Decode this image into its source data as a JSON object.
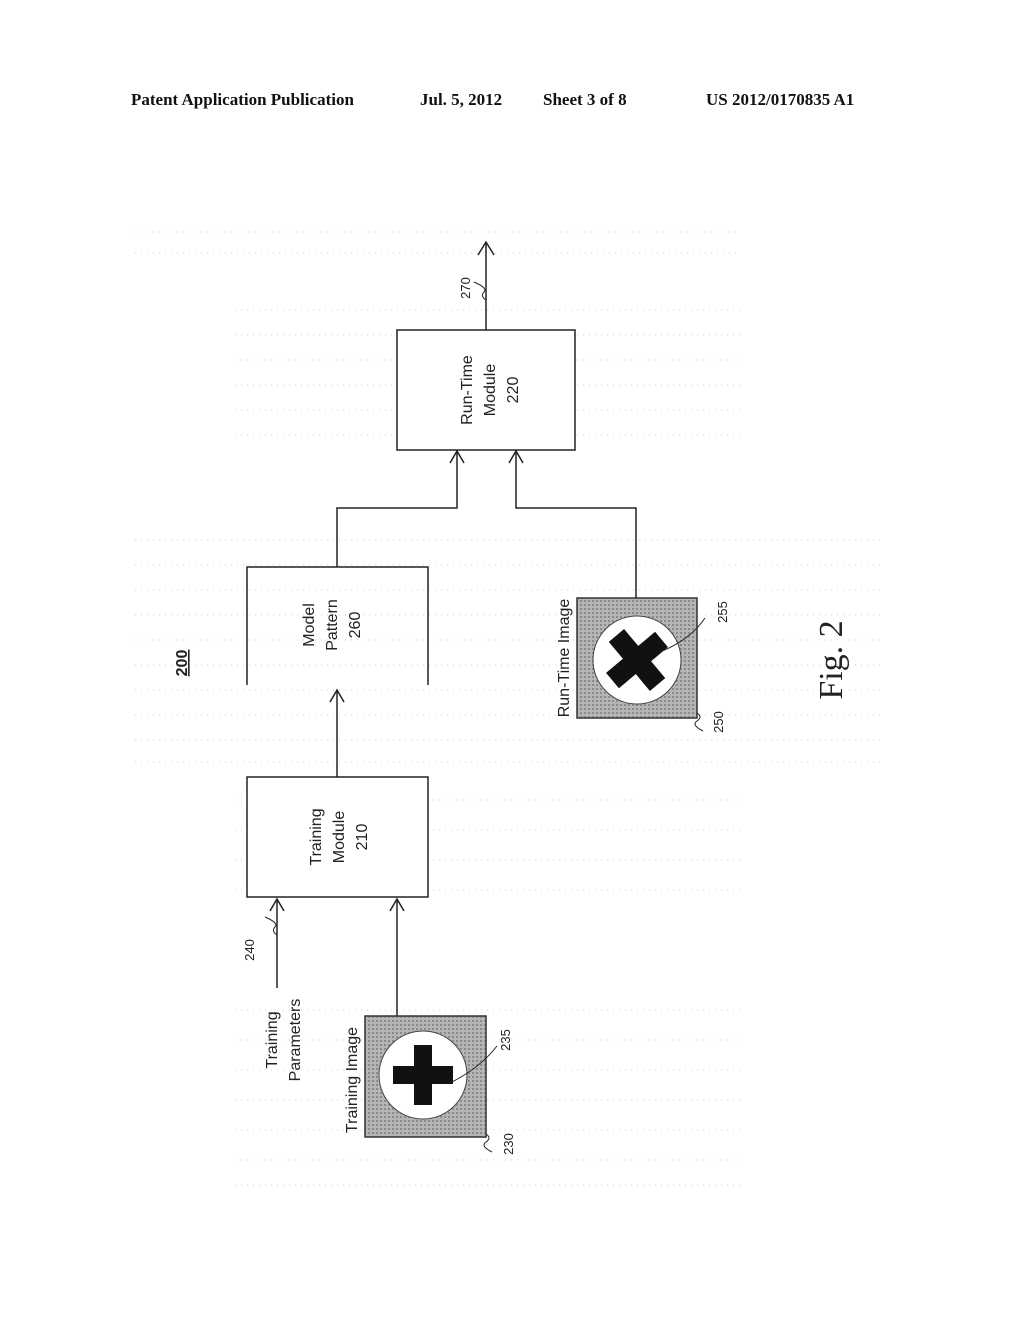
{
  "header": {
    "publication": "Patent Application Publication",
    "date": "Jul. 5, 2012",
    "sheet": "Sheet 3 of 8",
    "number": "US 2012/0170835 A1"
  },
  "figure": {
    "ref_number": "200",
    "caption": "Fig. 2"
  },
  "blocks": {
    "training_module": {
      "line1": "Training",
      "line2": "Module",
      "ref": "210"
    },
    "run_time_module": {
      "line1": "Run-Time",
      "line2": "Module",
      "ref": "220"
    },
    "model_pattern": {
      "line1": "Model",
      "line2": "Pattern",
      "ref": "260"
    }
  },
  "inputs": {
    "training_image": {
      "label": "Training Image",
      "ref": "230",
      "pattern_ref": "235"
    },
    "run_time_image": {
      "label": "Run-Time Image",
      "ref": "250",
      "pattern_ref": "255"
    },
    "training_parameters": {
      "line1": "Training",
      "line2": "Parameters",
      "ref": "240"
    }
  },
  "output": {
    "ref": "270"
  },
  "colors": {
    "line": "#222222",
    "image_fill": "#a8a8a8",
    "mark": "#111111"
  }
}
